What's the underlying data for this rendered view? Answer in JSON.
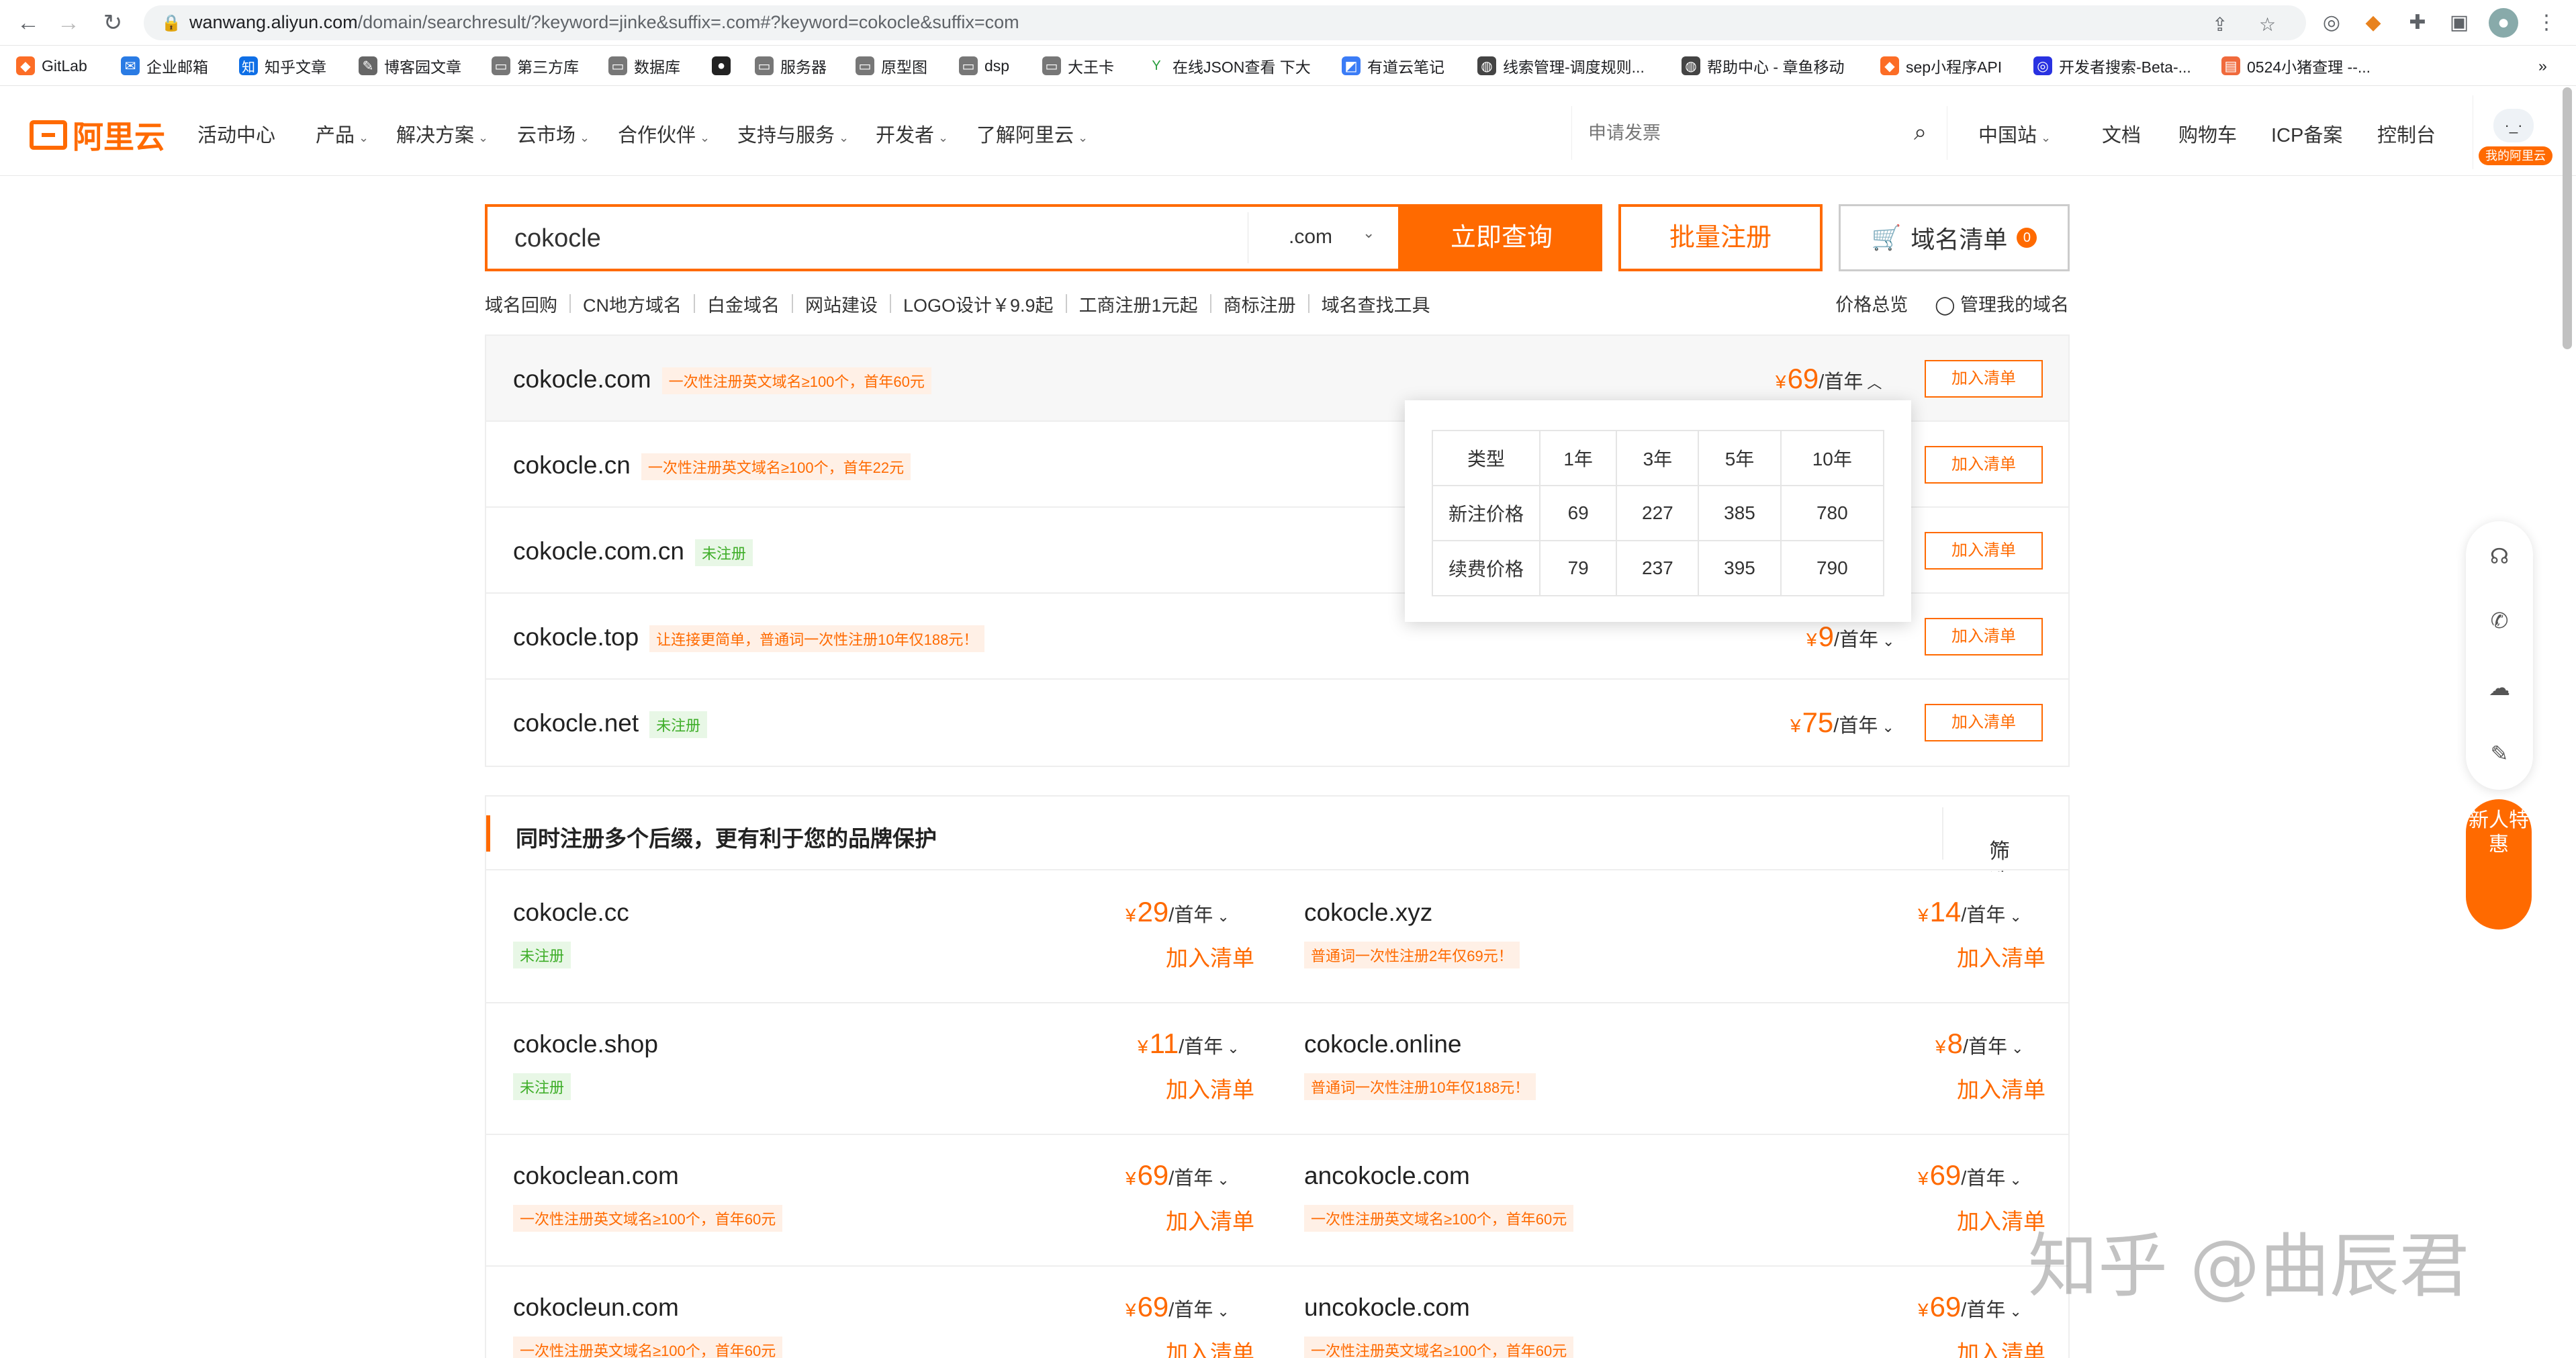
{
  "browser": {
    "url_host": "wanwang.aliyun.com",
    "url_path": "/domain/searchresult/?keyword=jinke&suffix=.com#?keyword=cokocle&suffix=com",
    "bookmarks": [
      "GitLab",
      "企业邮箱",
      "知乎文章",
      "博客园文章",
      "第三方库",
      "数据库",
      "",
      "服务器",
      "原型图",
      "dsp",
      "大王卡",
      "在线JSON查看 下大",
      "有道云笔记",
      "线索管理-调度规则...",
      "帮助中心 - 章鱼移动",
      "sep小程序API",
      "开发者搜索-Beta-...",
      "0524小猪查理 --..."
    ]
  },
  "header": {
    "logo_text": "阿里云",
    "nav": [
      "活动中心",
      "产品",
      "解决方案",
      "云市场",
      "合作伙伴",
      "支持与服务",
      "开发者",
      "了解阿里云"
    ],
    "search_placeholder": "申请发票",
    "right_nav": [
      "中国站",
      "文档",
      "购物车",
      "ICP备案",
      "控制台"
    ],
    "avatar_text": "·_·",
    "avatar_tag": "我的阿里云"
  },
  "search": {
    "keyword": "cokocle",
    "suffix": ".com",
    "query_button": "立即查询",
    "batch_button": "批量注册",
    "cart_button": "域名清单",
    "cart_count": "0"
  },
  "sublinks": [
    "域名回购",
    "CN地方域名",
    "白金域名",
    "网站建设",
    "LOGO设计￥9.9起",
    "工商注册1元起",
    "商标注册",
    "域名查找工具"
  ],
  "sublinks_right": [
    "价格总览",
    "管理我的域名"
  ],
  "results": [
    {
      "name": "cokocle.com",
      "tag": "一次性注册英文域名≥100个，首年60元",
      "tag_type": "orange",
      "price": "69",
      "per": "/首年",
      "add": "加入清单"
    },
    {
      "name": "cokocle.cn",
      "tag": "一次性注册英文域名≥100个，首年22元",
      "tag_type": "orange",
      "price": "",
      "per": "",
      "add": "加入清单"
    },
    {
      "name": "cokocle.com.cn",
      "tag": "未注册",
      "tag_type": "green",
      "price": "",
      "per": "",
      "add": "加入清单"
    },
    {
      "name": "cokocle.top",
      "tag": "让连接更简单，普通词一次性注册10年仅188元！",
      "tag_type": "orange",
      "price": "9",
      "per": "/首年",
      "add": "加入清单"
    },
    {
      "name": "cokocle.net",
      "tag": "未注册",
      "tag_type": "green",
      "price": "75",
      "per": "/首年",
      "add": "加入清单"
    }
  ],
  "price_popup": {
    "header": [
      "类型",
      "1年",
      "3年",
      "5年",
      "10年"
    ],
    "rows": [
      [
        "新注价格",
        "69",
        "227",
        "385",
        "780"
      ],
      [
        "续费价格",
        "79",
        "237",
        "395",
        "790"
      ]
    ]
  },
  "multi": {
    "title": "同时注册多个后缀，更有利于您的品牌保护",
    "filter": "筛选",
    "items": [
      {
        "name": "cokocle.cc",
        "tag": "未注册",
        "tag_type": "green",
        "price": "29",
        "per": "/首年",
        "add": "加入清单"
      },
      {
        "name": "cokocle.xyz",
        "tag": "普通词一次性注册2年仅69元！",
        "tag_type": "orange",
        "price": "14",
        "per": "/首年",
        "add": "加入清单"
      },
      {
        "name": "cokocle.shop",
        "tag": "未注册",
        "tag_type": "green",
        "price": "11",
        "per": "/首年",
        "add": "加入清单"
      },
      {
        "name": "cokocle.online",
        "tag": "普通词一次性注册10年仅188元！",
        "tag_type": "orange",
        "price": "8",
        "per": "/首年",
        "add": "加入清单"
      },
      {
        "name": "cokoclean.com",
        "tag": "一次性注册英文域名≥100个，首年60元",
        "tag_type": "orange",
        "price": "69",
        "per": "/首年",
        "add": "加入清单"
      },
      {
        "name": "ancokocle.com",
        "tag": "一次性注册英文域名≥100个，首年60元",
        "tag_type": "orange",
        "price": "69",
        "per": "/首年",
        "add": "加入清单"
      },
      {
        "name": "cokocleun.com",
        "tag": "一次性注册英文域名≥100个，首年60元",
        "tag_type": "orange",
        "price": "69",
        "per": "/首年",
        "add": "加入清单"
      },
      {
        "name": "uncokocle.com",
        "tag": "一次性注册英文域名≥100个，首年60元",
        "tag_type": "orange",
        "price": "69",
        "per": "/首年",
        "add": "加入清单"
      }
    ]
  },
  "promo_text": "新人特惠",
  "watermark": "知乎 @曲辰君",
  "colors": {
    "accent": "#ff6a00",
    "green": "#3fae29"
  }
}
